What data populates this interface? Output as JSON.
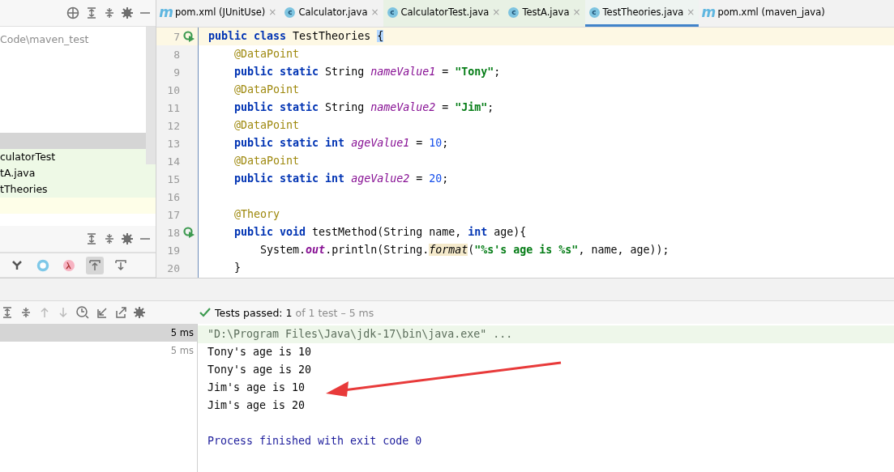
{
  "project_panel": {
    "path": "Code\\maven_test",
    "rows": [
      {
        "label": "",
        "kind": "selected"
      },
      {
        "label": "culatorTest",
        "kind": "test"
      },
      {
        "label": "tA.java",
        "kind": "test"
      },
      {
        "label": "tTheories",
        "kind": "test"
      },
      {
        "label": "",
        "kind": "current"
      }
    ]
  },
  "structure_toolbar": [
    {
      "kind": "fields"
    },
    {
      "kind": "circle"
    },
    {
      "kind": "lambda"
    },
    {
      "kind": "up",
      "selected": true
    },
    {
      "kind": "down",
      "selected": false
    }
  ],
  "tabs": [
    {
      "label": "pom.xml (JUnitUse)",
      "kind": "maven",
      "badge": "m",
      "selected": false,
      "close": "×"
    },
    {
      "label": "Calculator.java",
      "kind": "class",
      "badge": "c",
      "selected": false,
      "close": "×"
    },
    {
      "label": "CalculatorTest.java",
      "kind": "test",
      "badge": "c",
      "selected": false,
      "close": "×"
    },
    {
      "label": "TestA.java",
      "kind": "test",
      "badge": "c",
      "selected": false,
      "close": "×"
    },
    {
      "label": "TestTheories.java",
      "kind": "test",
      "badge": "c",
      "selected": true,
      "close": "×"
    },
    {
      "label": "pom.xml (maven_java)",
      "kind": "maven",
      "badge": "m",
      "selected": false
    }
  ],
  "code_lines": [
    {
      "number": "7",
      "run": true,
      "current": true,
      "tokens": [
        {
          "t": "public class ",
          "kind": "kw"
        },
        {
          "t": "TestTheories ",
          "kind": "plain"
        },
        {
          "t": "{",
          "kind": "brace"
        }
      ]
    },
    {
      "number": "8",
      "run": false,
      "current": false,
      "tokens": [
        {
          "t": "    @DataPoint",
          "kind": "ann"
        }
      ]
    },
    {
      "number": "9",
      "run": false,
      "current": false,
      "tokens": [
        {
          "t": "    public static ",
          "kind": "kw"
        },
        {
          "t": "String ",
          "kind": "plain"
        },
        {
          "t": "nameValue1",
          "kind": "field"
        },
        {
          "t": " = ",
          "kind": "plain"
        },
        {
          "t": "\"Tony\"",
          "kind": "str"
        },
        {
          "t": ";",
          "kind": "plain"
        }
      ]
    },
    {
      "number": "10",
      "run": false,
      "current": false,
      "tokens": [
        {
          "t": "    @DataPoint",
          "kind": "ann"
        }
      ]
    },
    {
      "number": "11",
      "run": false,
      "current": false,
      "tokens": [
        {
          "t": "    public static ",
          "kind": "kw"
        },
        {
          "t": "String ",
          "kind": "plain"
        },
        {
          "t": "nameValue2",
          "kind": "field"
        },
        {
          "t": " = ",
          "kind": "plain"
        },
        {
          "t": "\"Jim\"",
          "kind": "str"
        },
        {
          "t": ";",
          "kind": "plain"
        }
      ]
    },
    {
      "number": "12",
      "run": false,
      "current": false,
      "tokens": [
        {
          "t": "    @DataPoint",
          "kind": "ann"
        }
      ]
    },
    {
      "number": "13",
      "run": false,
      "current": false,
      "tokens": [
        {
          "t": "    public static int ",
          "kind": "kw"
        },
        {
          "t": "ageValue1",
          "kind": "field"
        },
        {
          "t": " = ",
          "kind": "plain"
        },
        {
          "t": "10",
          "kind": "num"
        },
        {
          "t": ";",
          "kind": "plain"
        }
      ]
    },
    {
      "number": "14",
      "run": false,
      "current": false,
      "tokens": [
        {
          "t": "    @DataPoint",
          "kind": "ann"
        }
      ]
    },
    {
      "number": "15",
      "run": false,
      "current": false,
      "tokens": [
        {
          "t": "    public static int ",
          "kind": "kw"
        },
        {
          "t": "ageValue2",
          "kind": "field"
        },
        {
          "t": " = ",
          "kind": "plain"
        },
        {
          "t": "20",
          "kind": "num"
        },
        {
          "t": ";",
          "kind": "plain"
        }
      ]
    },
    {
      "number": "16",
      "run": false,
      "current": false
    },
    {
      "number": "17",
      "run": false,
      "current": false,
      "tokens": [
        {
          "t": "    @Theory",
          "kind": "ann"
        }
      ]
    },
    {
      "number": "18",
      "run": true,
      "current": false,
      "tokens": [
        {
          "t": "    public void ",
          "kind": "kw"
        },
        {
          "t": "testMethod(String name, ",
          "kind": "plain"
        },
        {
          "t": "int ",
          "kind": "kw"
        },
        {
          "t": "age){",
          "kind": "plain"
        }
      ]
    },
    {
      "number": "19",
      "run": false,
      "current": false,
      "tokens": [
        {
          "t": "        System.",
          "kind": "plain"
        },
        {
          "t": "out",
          "kind": "static"
        },
        {
          "t": ".println(String.",
          "kind": "plain"
        },
        {
          "t": "format",
          "kind": "method"
        },
        {
          "t": "(",
          "kind": "plain"
        },
        {
          "t": "\"%s's age is %s\"",
          "kind": "str"
        },
        {
          "t": ", name, age));",
          "kind": "plain"
        }
      ]
    },
    {
      "number": "20",
      "run": false,
      "current": false,
      "tokens": [
        {
          "t": "    }",
          "kind": "plain"
        }
      ]
    }
  ],
  "test_status": {
    "label": "Tests passed:",
    "count": "1",
    "detail": "of 1 test – 5 ms"
  },
  "test_results": [
    {
      "time": "5 ms",
      "selected": true
    },
    {
      "time": "5 ms",
      "selected": false
    }
  ],
  "console": [
    {
      "text": "\"D:\\Program Files\\Java\\jdk-17\\bin\\java.exe\" ...",
      "kind": "command"
    },
    {
      "text": "Tony's age is 10",
      "kind": "output"
    },
    {
      "text": "Tony's age is 20",
      "kind": "output"
    },
    {
      "text": "Jim's age is 10",
      "kind": "output"
    },
    {
      "text": "Jim's age is 20",
      "kind": "output"
    },
    {
      "text": "Process finished with exit code 0",
      "kind": "exit"
    }
  ]
}
